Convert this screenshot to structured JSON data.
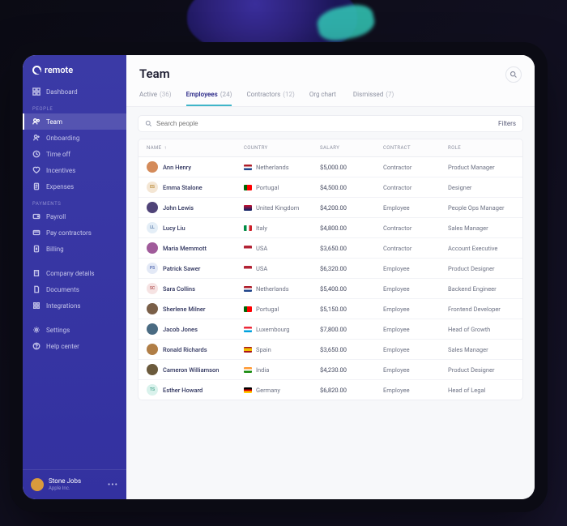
{
  "brand": "remote",
  "sidebar": {
    "dashboard": "Dashboard",
    "groups": {
      "people": "PEOPLE",
      "payments": "PAYMENTS"
    },
    "people": {
      "team": "Team",
      "onboarding": "Onboarding",
      "timeoff": "Time off",
      "incentives": "Incentives",
      "expenses": "Expenses"
    },
    "payments": {
      "payroll": "Payroll",
      "paycontractors": "Pay contractors",
      "billing": "Billing"
    },
    "bottom": {
      "company": "Company details",
      "documents": "Documents",
      "integrations": "Integrations",
      "settings": "Settings",
      "help": "Help center"
    },
    "footer": {
      "name": "Stone Jobs",
      "sub": "Apple Inc."
    }
  },
  "page": {
    "title": "Team"
  },
  "tabs": {
    "active": {
      "label": "Active",
      "count": "(36)"
    },
    "employees": {
      "label": "Employees",
      "count": "(24)"
    },
    "contractors": {
      "label": "Contractors",
      "count": "(12)"
    },
    "orgchart": {
      "label": "Org chart",
      "count": ""
    },
    "dismissed": {
      "label": "Dismissed",
      "count": "(7)"
    }
  },
  "search": {
    "placeholder": "Search people",
    "filters": "Filters"
  },
  "columns": {
    "name": "NAME",
    "country": "COUNTRY",
    "salary": "SALARY",
    "contract": "CONTRACT",
    "role": "ROLE"
  },
  "rows": [
    {
      "name": "Ann Henry",
      "country": "Netherlands",
      "flag": "nl",
      "salary": "$5,000.00",
      "contract": "Contractor",
      "role": "Product Manager",
      "av": {
        "type": "photo",
        "bg": "#d48b5a"
      }
    },
    {
      "name": "Emma Stalone",
      "country": "Portugal",
      "flag": "pt",
      "salary": "$4,500.00",
      "contract": "Contractor",
      "role": "Designer",
      "av": {
        "type": "initials",
        "text": "ES",
        "bg": "#f4e6d4",
        "fg": "#b98b3a"
      }
    },
    {
      "name": "John Lewis",
      "country": "United Kingdom",
      "flag": "uk",
      "salary": "$4,200.00",
      "contract": "Employee",
      "role": "People Ops Manager",
      "av": {
        "type": "photo",
        "bg": "#4f4378"
      }
    },
    {
      "name": "Lucy Liu",
      "country": "Italy",
      "flag": "it",
      "salary": "$4,800.00",
      "contract": "Contractor",
      "role": "Sales Manager",
      "av": {
        "type": "initials",
        "text": "LL",
        "bg": "#e4eef7",
        "fg": "#5b7ba8"
      }
    },
    {
      "name": "Maria Memmott",
      "country": "USA",
      "flag": "us",
      "salary": "$3,650.00",
      "contract": "Contractor",
      "role": "Account Executive",
      "av": {
        "type": "photo",
        "bg": "#a05b9a"
      }
    },
    {
      "name": "Patrick Sawer",
      "country": "USA",
      "flag": "us",
      "salary": "$6,320.00",
      "contract": "Employee",
      "role": "Product Designer",
      "av": {
        "type": "initials",
        "text": "PS",
        "bg": "#e3e9f6",
        "fg": "#5a6fb3"
      }
    },
    {
      "name": "Sara Collins",
      "country": "Netherlands",
      "flag": "nl",
      "salary": "$5,400.00",
      "contract": "Employee",
      "role": "Backend Engineer",
      "av": {
        "type": "initials",
        "text": "SC",
        "bg": "#f6e3e3",
        "fg": "#b35a5a"
      }
    },
    {
      "name": "Sherlene Milner",
      "country": "Portugal",
      "flag": "pt",
      "salary": "$5,150.00",
      "contract": "Employee",
      "role": "Frontend Developer",
      "av": {
        "type": "photo",
        "bg": "#7a5f48"
      }
    },
    {
      "name": "Jacob Jones",
      "country": "Luxembourg",
      "flag": "lu",
      "salary": "$7,800.00",
      "contract": "Employee",
      "role": "Head of Growth",
      "av": {
        "type": "photo",
        "bg": "#4a6b82"
      }
    },
    {
      "name": "Ronald Richards",
      "country": "Spain",
      "flag": "es",
      "salary": "$3,650.00",
      "contract": "Employee",
      "role": "Sales Manager",
      "av": {
        "type": "photo",
        "bg": "#b07e46"
      }
    },
    {
      "name": "Cameron Williamson",
      "country": "India",
      "flag": "in",
      "salary": "$4,230.00",
      "contract": "Employee",
      "role": "Product Designer",
      "av": {
        "type": "photo",
        "bg": "#6b5a3c"
      }
    },
    {
      "name": "Esther Howard",
      "country": "Germany",
      "flag": "de",
      "salary": "$6,820.00",
      "contract": "Employee",
      "role": "Head of Legal",
      "av": {
        "type": "initials",
        "text": "TS",
        "bg": "#d9f2ec",
        "fg": "#4aa58c"
      }
    }
  ],
  "flags": {
    "nl": "linear-gradient(#ae1c28 33.3%, #fff 33.3% 66.6%, #21468b 66.6%)",
    "pt": "linear-gradient(90deg,#006600 40%, #ff0000 40%)",
    "uk": "linear-gradient(#c8102e, #012169)",
    "it": "linear-gradient(90deg,#008c45 33.3%, #fff 33.3% 66.6%, #cd212a 66.6%)",
    "us": "linear-gradient(#b22234 50%, #fff 50%)",
    "lu": "linear-gradient(#ed2939 33.3%, #fff 33.3% 66.6%, #00a1de 66.6%)",
    "es": "linear-gradient(#aa151b 25%, #f1bf00 25% 75%, #aa151b 75%)",
    "in": "linear-gradient(#ff9933 33.3%, #fff 33.3% 66.6%, #138808 66.6%)",
    "de": "linear-gradient(#000 33.3%, #dd0000 33.3% 66.6%, #ffce00 66.6%)"
  }
}
